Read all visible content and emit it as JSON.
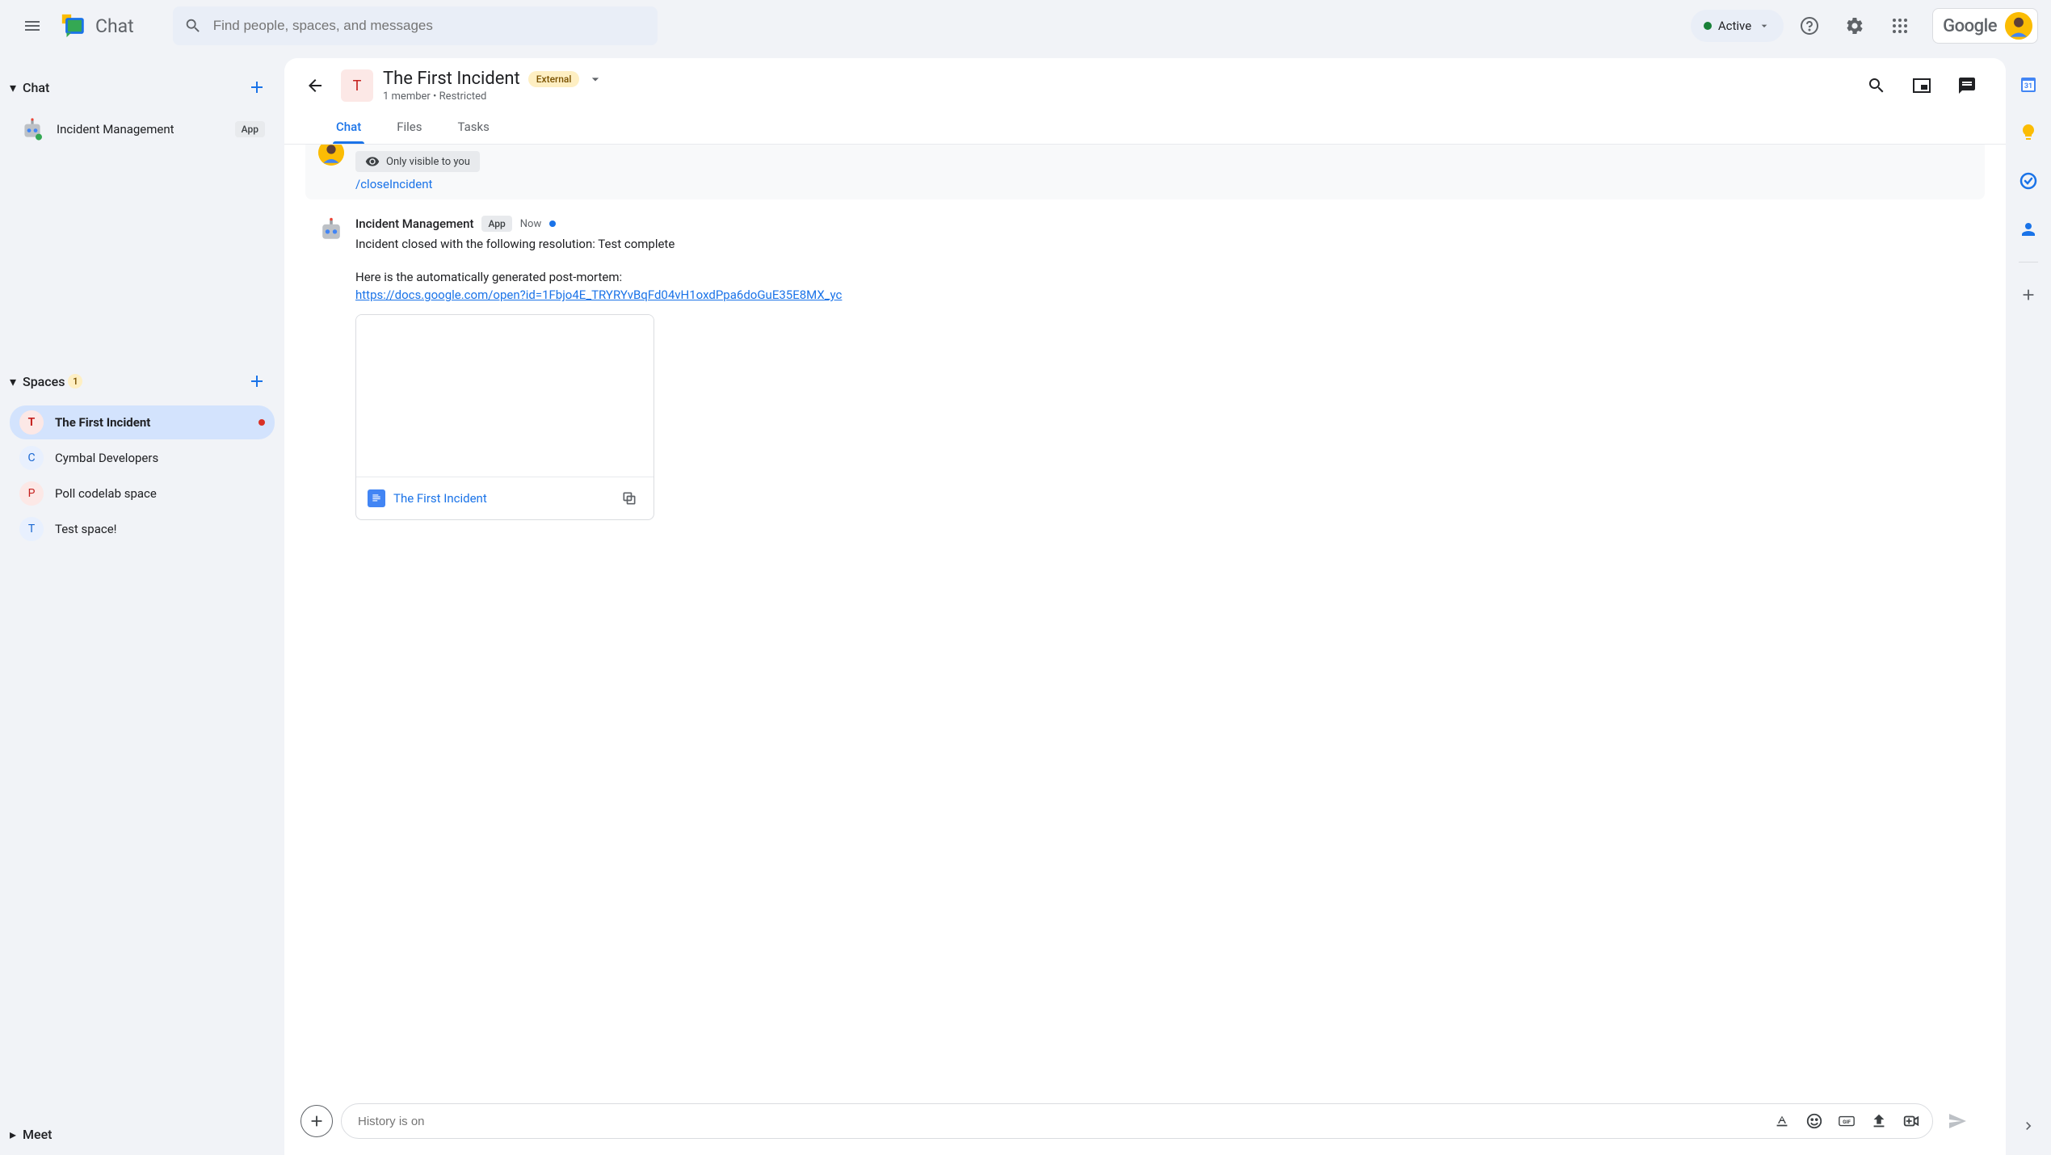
{
  "header": {
    "app_title": "Chat",
    "search_placeholder": "Find people, spaces, and messages",
    "status_label": "Active",
    "brand": "Google"
  },
  "sidebar": {
    "sections": {
      "chat": {
        "title": "Chat"
      },
      "spaces": {
        "title": "Spaces",
        "count": "1"
      },
      "meet": {
        "title": "Meet"
      }
    },
    "chat_items": [
      {
        "label": "Incident Management",
        "app_tag": "App"
      }
    ],
    "space_items": [
      {
        "letter": "T",
        "label": "The First Incident",
        "bg": "#fce8e6",
        "fg": "#c5221f",
        "active": true,
        "unread": true
      },
      {
        "letter": "C",
        "label": "Cymbal Developers",
        "bg": "#e8f0fe",
        "fg": "#1967d2"
      },
      {
        "letter": "P",
        "label": "Poll codelab space",
        "bg": "#fce8e6",
        "fg": "#c5221f"
      },
      {
        "letter": "T",
        "label": "Test space!",
        "bg": "#e8f0fe",
        "fg": "#1967d2"
      }
    ]
  },
  "conversation": {
    "title": "The First Incident",
    "external_badge": "External",
    "subtitle": "1 member  •  Restricted",
    "tabs": [
      {
        "label": "Chat",
        "active": true
      },
      {
        "label": "Files"
      },
      {
        "label": "Tasks"
      }
    ],
    "visibility_text": "Only visible to you",
    "command_text": "/closeIncident",
    "bot_message": {
      "sender": "Incident Management",
      "app_tag": "App",
      "timestamp": "Now",
      "line1": "Incident closed with the following resolution: Test complete",
      "line2": "Here is the automatically generated post-mortem:",
      "link": "https://docs.google.com/open?id=1Fbjo4E_TRYRYvBqFd04vH1oxdPpa6doGuE35E8MX_yc"
    },
    "doc_card": {
      "title": "The First Incident"
    },
    "composer_placeholder": "History is on"
  },
  "colors": {
    "accent": "#1a73e8",
    "green": "#188038",
    "red": "#d93025"
  }
}
